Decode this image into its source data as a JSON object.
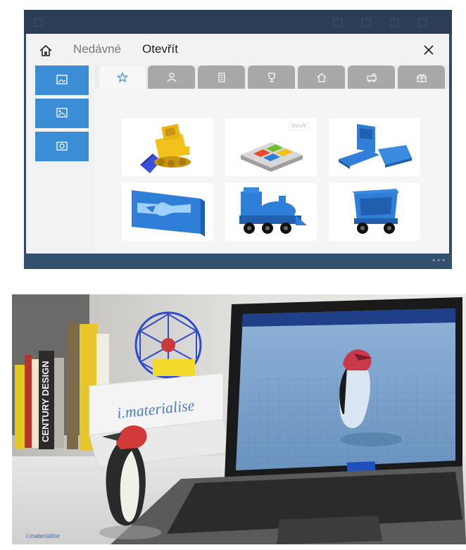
{
  "dialog": {
    "nav": {
      "recent": "Nedávné",
      "open": "Otevřít"
    },
    "tile_badge": "Otevřít"
  },
  "icons": {
    "home": "home-icon",
    "close": "close-icon",
    "tabs": [
      "star-icon",
      "person-icon",
      "building-icon",
      "trophy-icon",
      "house-icon",
      "vehicle-icon",
      "gift-icon"
    ]
  },
  "photo": {
    "box_brand": "i.materialise",
    "book_spine": "CENTURY DESIGN",
    "caption": "i.materialise"
  },
  "colors": {
    "accent": "#3b8ed6",
    "model_blue": "#2f7fd8",
    "tab_inactive": "#a8a8a8"
  }
}
